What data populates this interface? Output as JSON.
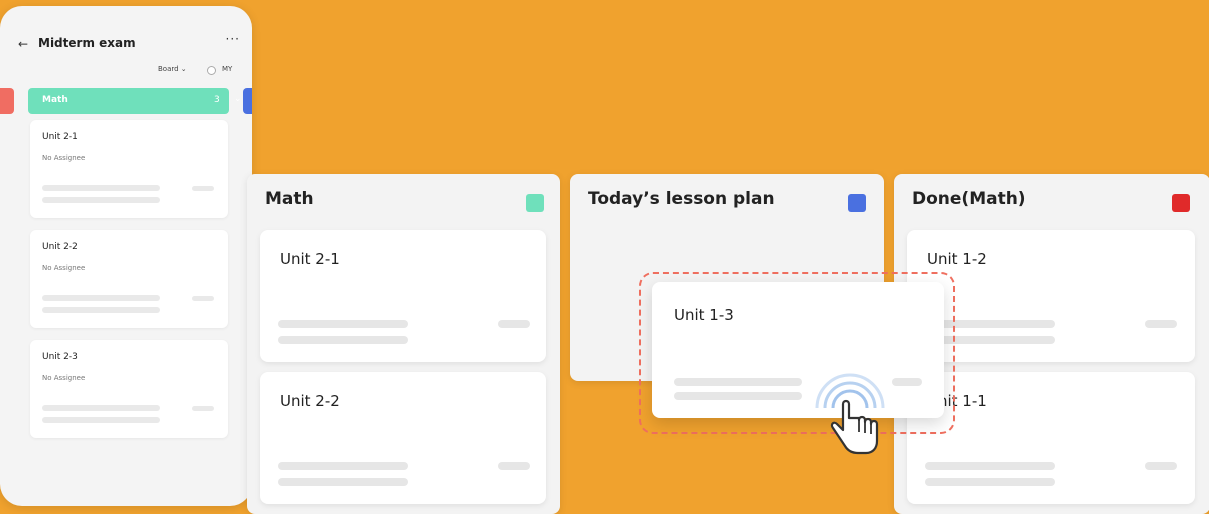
{
  "phone": {
    "title": "Midterm exam",
    "view_select": "Board",
    "my_toggle_label": "MY",
    "column": {
      "title": "Math",
      "count": "3",
      "color": "#6FE0BB"
    },
    "cards": [
      {
        "title": "Unit 2-1",
        "assignee": "No Assignee"
      },
      {
        "title": "Unit 2-2",
        "assignee": "No Assignee"
      },
      {
        "title": "Unit 2-3",
        "assignee": "No Assignee"
      }
    ],
    "icons": {
      "back": "back-arrow-icon",
      "more": "more-options-icon"
    }
  },
  "board": {
    "columns": [
      {
        "title": "Math",
        "color": "#6FE0BB",
        "cards": [
          "Unit 2-1",
          "Unit 2-2"
        ]
      },
      {
        "title": "Today’s lesson plan",
        "color": "#4A70E0",
        "cards": []
      },
      {
        "title": "Done(Math)",
        "color": "#E02A2A",
        "cards": [
          "Unit 1-2",
          "Unit 1-1"
        ]
      }
    ],
    "dragging_card": {
      "title": "Unit 1-3"
    }
  },
  "colors": {
    "background": "#F0A22E",
    "drop_outline": "#EF6F5F"
  }
}
